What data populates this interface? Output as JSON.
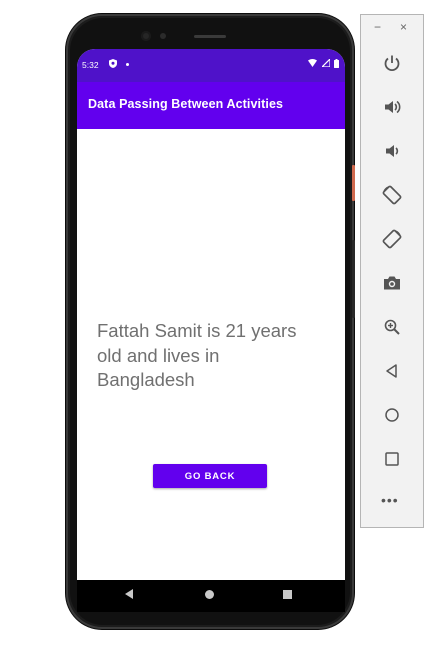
{
  "status_bar": {
    "time": "5:32",
    "color": "#4f12c9"
  },
  "app_bar": {
    "title": "Data Passing Between Activities",
    "color": "#6200ee"
  },
  "content": {
    "message": "Fattah Samit is 21 years old and lives in Bangladesh"
  },
  "actions": {
    "go_back_label": "GO BACK"
  },
  "emulator_panel": {
    "window_controls": {
      "minimize": "−",
      "close": "×"
    },
    "buttons": [
      "power-icon",
      "volume-up-icon",
      "volume-down-icon",
      "rotate-left-icon",
      "rotate-right-icon",
      "camera-icon",
      "zoom-icon",
      "back-icon",
      "home-icon",
      "overview-icon"
    ],
    "more_label": "•••"
  }
}
